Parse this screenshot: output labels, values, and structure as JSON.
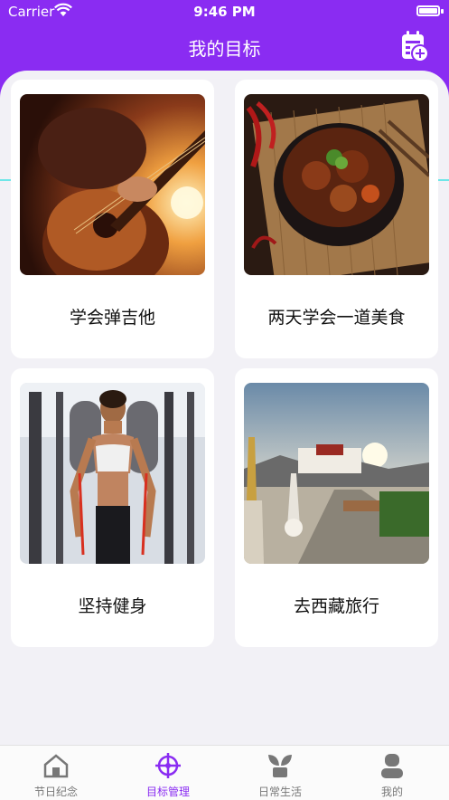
{
  "status": {
    "carrier": "Carrier",
    "time": "9:46 PM"
  },
  "nav": {
    "title": "我的目标"
  },
  "goals": [
    {
      "label": "学会弹吉他",
      "image": "guitar-photo"
    },
    {
      "label": "两天学会一道美食",
      "image": "braised-meat-dish-photo"
    },
    {
      "label": "坚持健身",
      "image": "gym-woman-photo"
    },
    {
      "label": "去西藏旅行",
      "image": "potala-palace-photo"
    }
  ],
  "tabs": [
    {
      "label": "节日纪念",
      "icon": "home-icon",
      "active": false
    },
    {
      "label": "目标管理",
      "icon": "crosshair-target-icon",
      "active": true
    },
    {
      "label": "日常生活",
      "icon": "sprout-icon",
      "active": false
    },
    {
      "label": "我的",
      "icon": "person-icon",
      "active": false
    }
  ],
  "colors": {
    "accent": "#8a2cf2",
    "teal": "#6fe6e8",
    "background": "#f2f1f6"
  }
}
